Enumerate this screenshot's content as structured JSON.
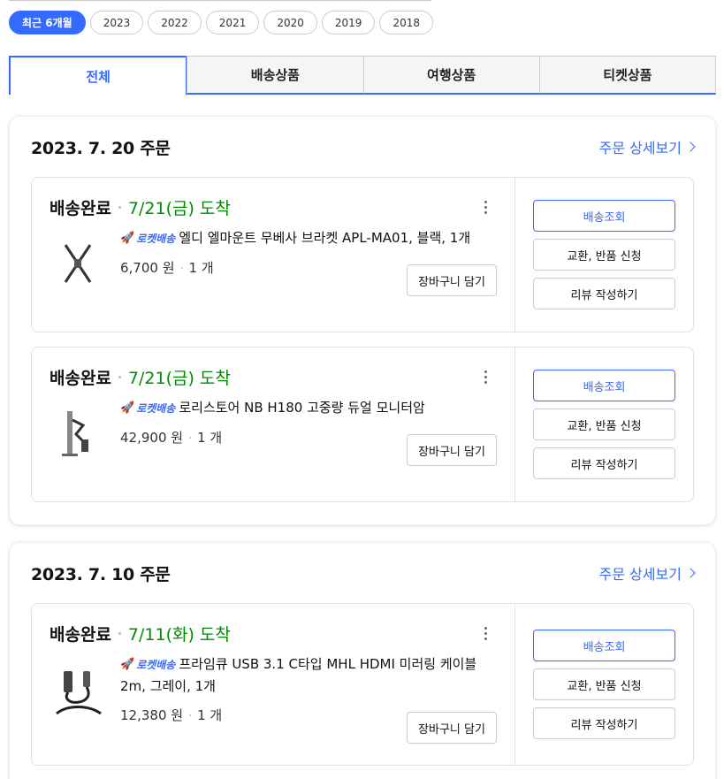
{
  "year_filter": {
    "chips": [
      {
        "label": "최근 6개월",
        "active": true
      },
      {
        "label": "2023",
        "active": false
      },
      {
        "label": "2022",
        "active": false
      },
      {
        "label": "2021",
        "active": false
      },
      {
        "label": "2020",
        "active": false
      },
      {
        "label": "2019",
        "active": false
      },
      {
        "label": "2018",
        "active": false
      }
    ]
  },
  "tabs": [
    {
      "label": "전체",
      "active": true
    },
    {
      "label": "배송상품",
      "active": false
    },
    {
      "label": "여행상품",
      "active": false
    },
    {
      "label": "티켓상품",
      "active": false
    }
  ],
  "orders": [
    {
      "date": "2023. 7. 20 주문",
      "detail_link": "주문 상세보기",
      "items": [
        {
          "status": "배송완료",
          "arrival": "7/21(금) 도착",
          "badge": "로켓배송",
          "icon": "monitor-bracket-thumb",
          "name": "엘디 엘마운트 무베사 브라켓 APL-MA01, 블랙, 1개",
          "price": "6,700 원",
          "qty": "1 개",
          "cart_label": "장바구니 담기",
          "actions": {
            "track": "배송조회",
            "exchange": "교환, 반품 신청",
            "review": "리뷰 작성하기"
          }
        },
        {
          "status": "배송완료",
          "arrival": "7/21(금) 도착",
          "badge": "로켓배송",
          "icon": "monitor-arm-thumb",
          "name": "로리스토어 NB H180 고중량 듀얼 모니터암",
          "price": "42,900 원",
          "qty": "1 개",
          "cart_label": "장바구니 담기",
          "actions": {
            "track": "배송조회",
            "exchange": "교환, 반품 신청",
            "review": "리뷰 작성하기"
          }
        }
      ]
    },
    {
      "date": "2023. 7. 10 주문",
      "detail_link": "주문 상세보기",
      "items": [
        {
          "status": "배송완료",
          "arrival": "7/11(화) 도착",
          "badge": "로켓배송",
          "icon": "hdmi-cable-thumb",
          "name": "프라임큐 USB 3.1 C타입 MHL HDMI 미러링 케이블 2m, 그레이, 1개",
          "price": "12,380 원",
          "qty": "1 개",
          "cart_label": "장바구니 담기",
          "actions": {
            "track": "배송조회",
            "exchange": "교환, 반품 신청",
            "review": "리뷰 작성하기"
          }
        }
      ]
    }
  ],
  "colors": {
    "accent": "#346aff",
    "arrival": "#008c00"
  }
}
